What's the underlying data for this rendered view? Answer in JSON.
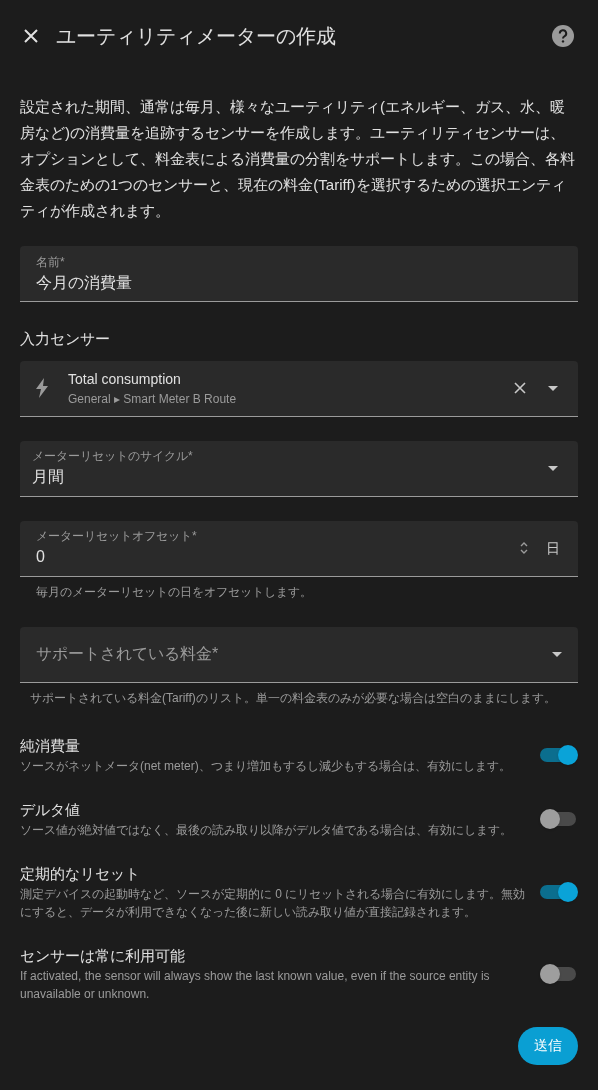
{
  "dialog": {
    "title": "ユーティリティメーターの作成"
  },
  "description": "設定された期間、通常は毎月、様々なユーティリティ(エネルギー、ガス、水、暖房など)の消費量を追跡するセンサーを作成します。ユーティリティセンサーは、オプションとして、料金表による消費量の分割をサポートします。この場合、各料金表のための1つのセンサーと、現在の料金(Tariff)を選択するための選択エンティティが作成されます。",
  "name_field": {
    "label": "名前*",
    "value": "今月の消費量"
  },
  "input_sensor": {
    "heading": "入力センサー",
    "entity_name": "Total consumption",
    "entity_path": "General ▸ Smart Meter B Route"
  },
  "reset_cycle": {
    "label": "メーターリセットのサイクル*",
    "value": "月間"
  },
  "reset_offset": {
    "label": "メーターリセットオフセット*",
    "value": "0",
    "unit": "日",
    "helper": "毎月のメーターリセットの日をオフセットします。"
  },
  "tariffs": {
    "label": "サポートされている料金*",
    "helper": "サポートされている料金(Tariff)のリスト。単一の料金表のみが必要な場合は空白のままにします。"
  },
  "toggles": [
    {
      "title": "純消費量",
      "description": "ソースがネットメータ(net meter)、つまり増加もするし減少もする場合は、有効にします。",
      "on": true
    },
    {
      "title": "デルタ値",
      "description": "ソース値が絶対値ではなく、最後の読み取り以降がデルタ値である場合は、有効にします。",
      "on": false
    },
    {
      "title": "定期的なリセット",
      "description": "測定デバイスの起動時など、ソースが定期的に 0 にリセットされる場合に有効にします。無効にすると、データが利用できなくなった後に新しい読み取り値が直接記録されます。",
      "on": true
    },
    {
      "title": "センサーは常に利用可能",
      "description": "If activated, the sensor will always show the last known value, even if the source entity is unavailable or unknown.",
      "on": false
    }
  ],
  "submit": "送信"
}
